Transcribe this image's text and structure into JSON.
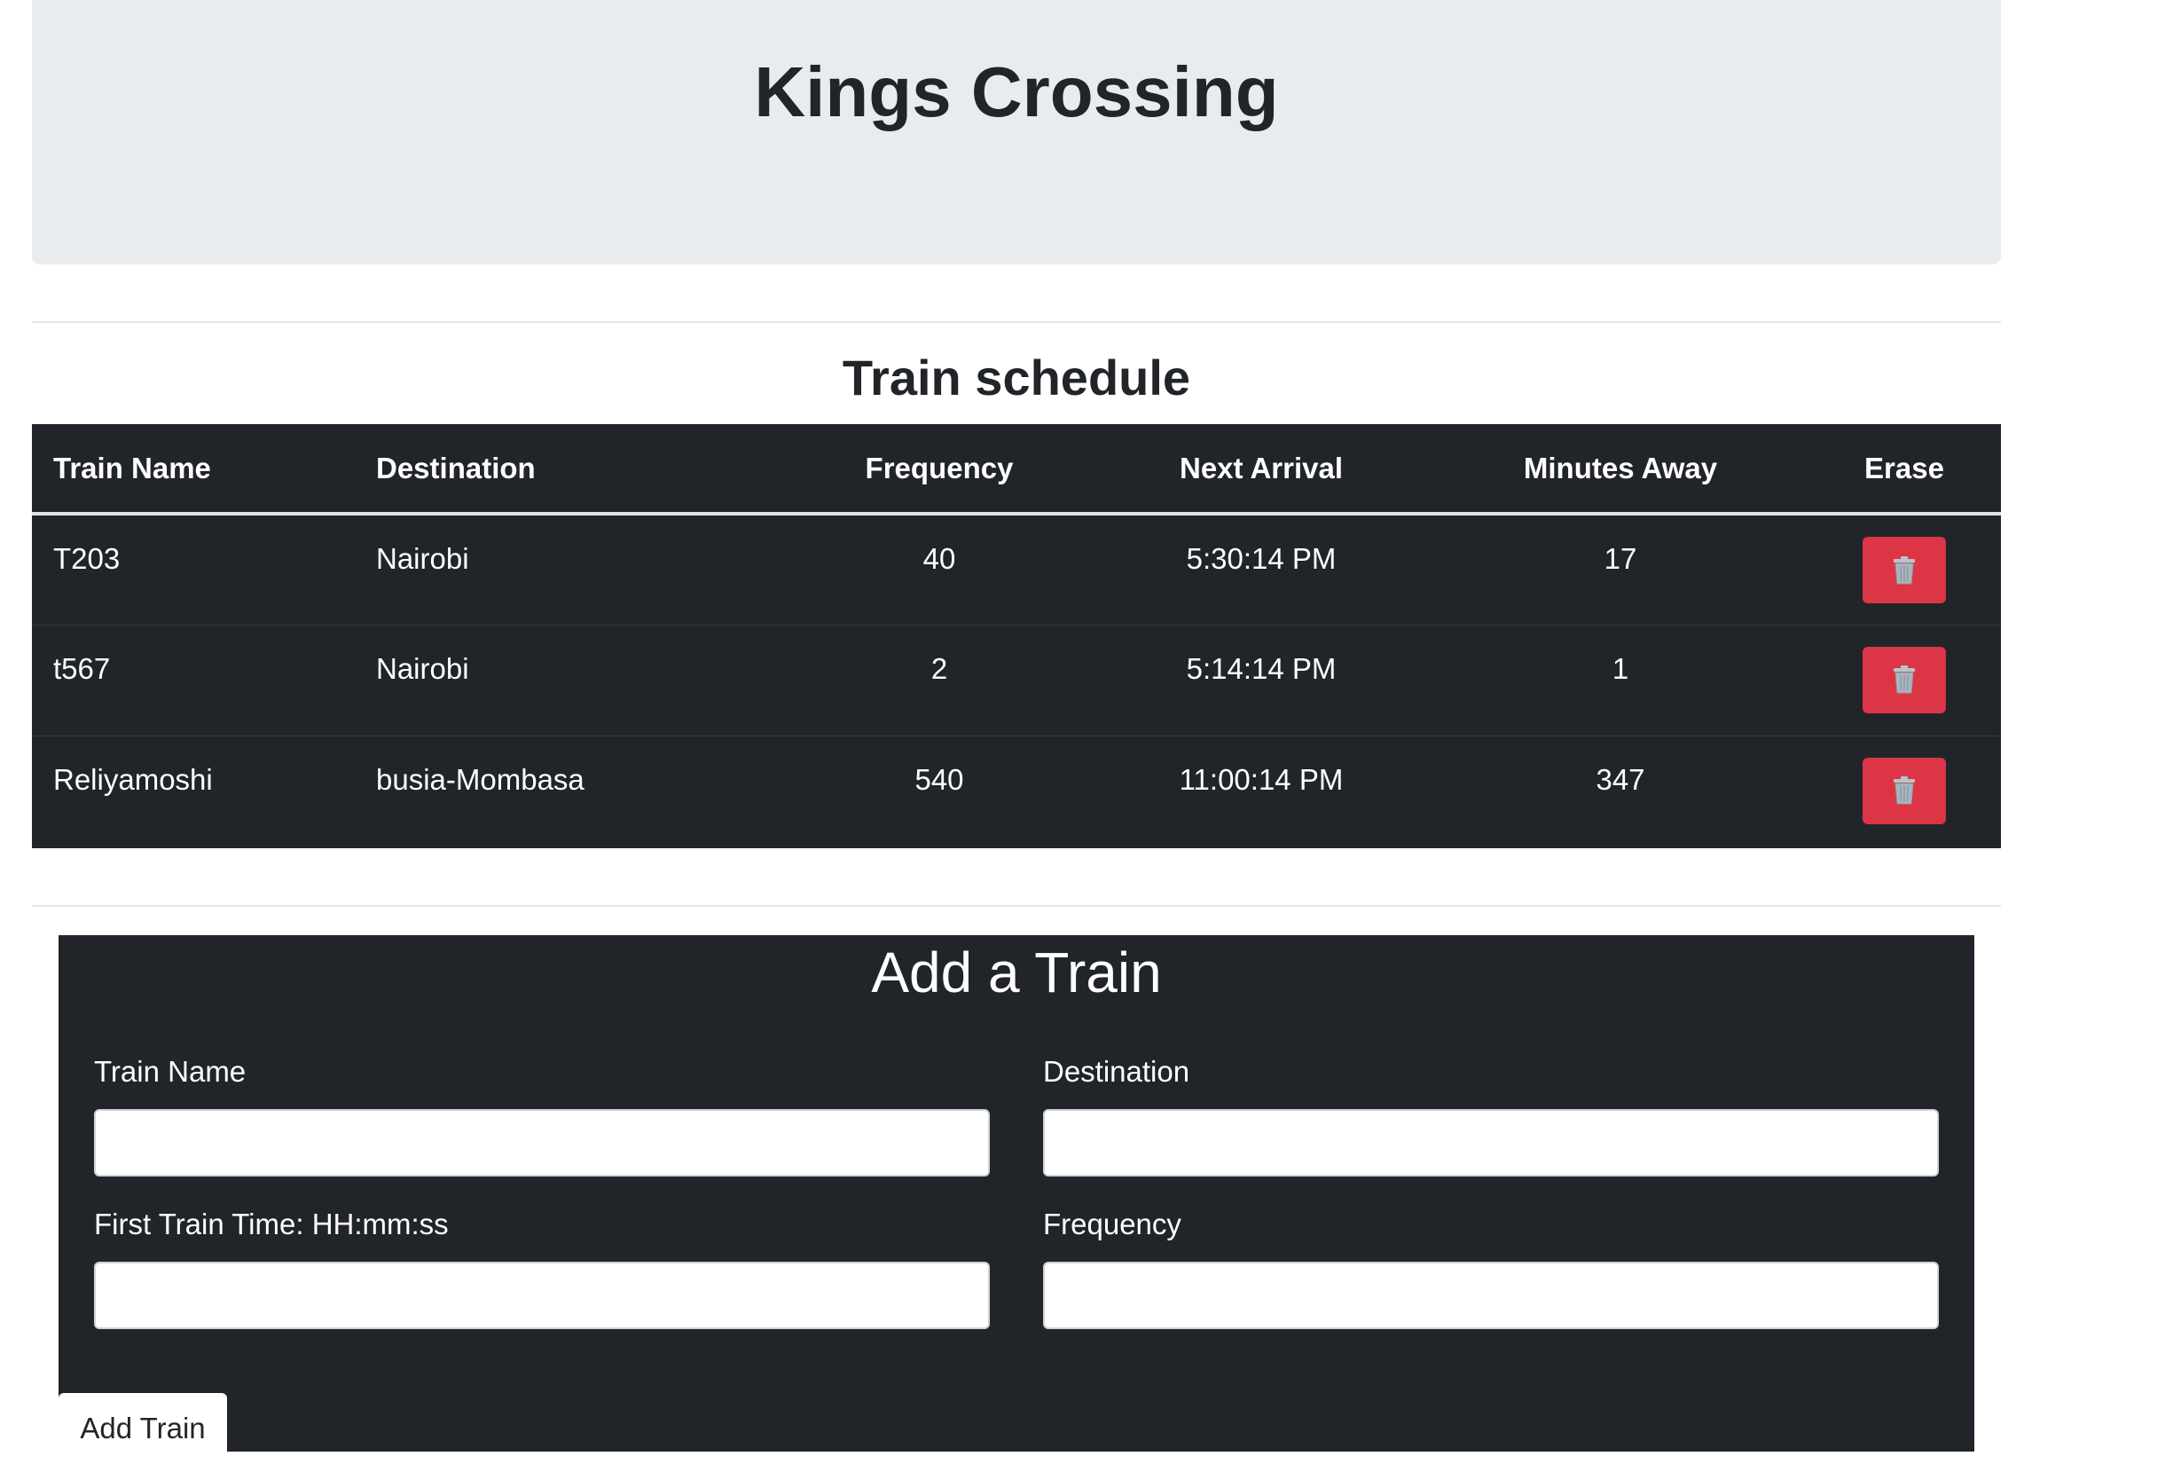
{
  "header": {
    "title": "Kings Crossing"
  },
  "schedule": {
    "title": "Train schedule",
    "columns": {
      "name": "Train Name",
      "destination": "Destination",
      "frequency": "Frequency",
      "next_arrival": "Next Arrival",
      "minutes_away": "Minutes Away",
      "erase": "Erase"
    },
    "rows": [
      {
        "name": "T203",
        "destination": "Nairobi",
        "frequency": "40",
        "next_arrival": "5:30:14 PM",
        "minutes_away": "17"
      },
      {
        "name": "t567",
        "destination": "Nairobi",
        "frequency": "2",
        "next_arrival": "5:14:14 PM",
        "minutes_away": "1"
      },
      {
        "name": "Reliyamoshi",
        "destination": "busia-Mombasa",
        "frequency": "540",
        "next_arrival": "11:00:14 PM",
        "minutes_away": "347"
      }
    ],
    "erase_icon": "trash-icon"
  },
  "form": {
    "title": "Add a Train",
    "train_name_label": "Train Name",
    "train_name_value": "",
    "destination_label": "Destination",
    "destination_value": "",
    "first_time_label": "First Train Time: HH:mm:ss",
    "first_time_value": "",
    "frequency_label": "Frequency",
    "frequency_value": "",
    "submit_label": "Add Train"
  },
  "colors": {
    "jumbotron_bg": "#e9ecef",
    "dark_bg": "#212529",
    "danger": "#dc3545"
  }
}
